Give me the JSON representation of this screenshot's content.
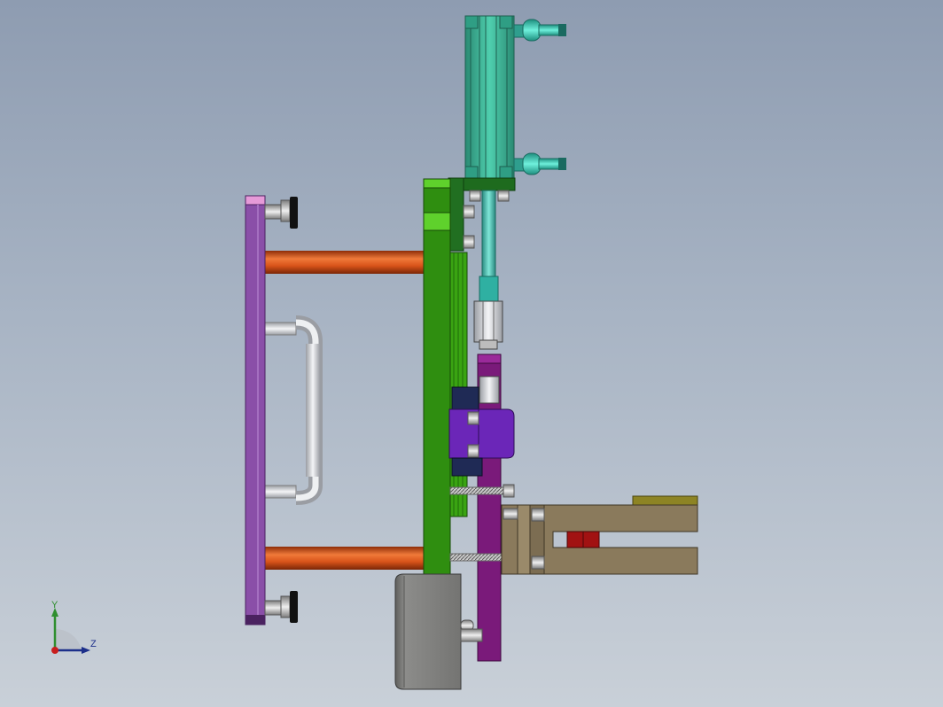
{
  "viewport": {
    "background_top": "#8e9cb1",
    "background_bottom": "#c9d0d8"
  },
  "model": {
    "colors": {
      "cylinder_body": "#3fb89b",
      "cylinder_dark": "#2a8a73",
      "fitting": "#3fc6b0",
      "mount_plate": "#2f8e10",
      "mount_plate_light": "#5fd12c",
      "bracket": "#1e6b1e",
      "back_plate": "#8a4fa8",
      "back_plate_top": "#e69ad8",
      "guide_rod": "#d9541a",
      "handle": "#d4d6da",
      "slide": "#7a1a7a",
      "block_purple": "#6b26b8",
      "block_navy": "#1f2a55",
      "gripper": "#8a7a5c",
      "gripper_top": "#8d8424",
      "pad_red": "#a11212",
      "base_block": "#7a7a78",
      "bolt": "#c9c9c9"
    },
    "parts": [
      "pneumatic-cylinder",
      "air-fitting-upper",
      "air-fitting-lower",
      "cylinder-bracket",
      "mounting-plate",
      "back-plate",
      "guide-rod-upper",
      "guide-rod-lower",
      "handle",
      "piston-rod",
      "floating-joint",
      "slide-bar",
      "clamp-block",
      "gripper-jaw",
      "base-block"
    ]
  },
  "triad": {
    "x_color": "#c81e1e",
    "y_label": "Y",
    "y_color": "#2f8f2f",
    "z_label": "Z",
    "z_color": "#1c2f8a"
  }
}
